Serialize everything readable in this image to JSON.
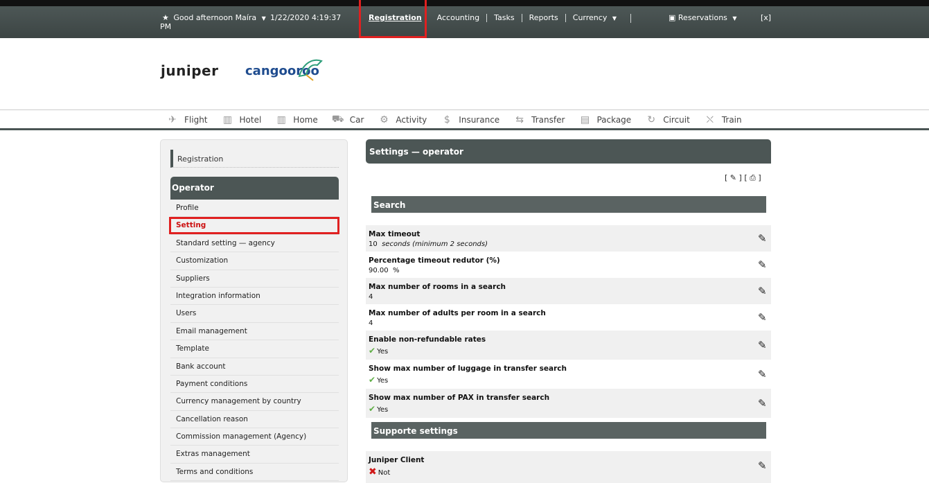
{
  "topbar": {
    "greeting": "Good afternoon Maíra",
    "datetime": "1/22/2020 4:19:37",
    "datetime_suffix": "PM",
    "nav": [
      "Registration",
      "Accounting",
      "Tasks",
      "Reports",
      "Currency"
    ],
    "reservations": "Reservations",
    "close": "[x]"
  },
  "logos": {
    "juniper": "juniper",
    "cangooroo": "cangooroo"
  },
  "products": [
    {
      "label": "Flight",
      "icon": "plane-icon"
    },
    {
      "label": "Hotel",
      "icon": "building-icon"
    },
    {
      "label": "Home",
      "icon": "home-icon"
    },
    {
      "label": "Car",
      "icon": "car-icon"
    },
    {
      "label": "Activity",
      "icon": "activity-icon"
    },
    {
      "label": "Insurance",
      "icon": "dollar-icon"
    },
    {
      "label": "Transfer",
      "icon": "transfer-icon"
    },
    {
      "label": "Package",
      "icon": "package-icon"
    },
    {
      "label": "Circuit",
      "icon": "circuit-icon"
    },
    {
      "label": "Train",
      "icon": "train-icon"
    }
  ],
  "sidebar": {
    "breadcrumb": "Registration",
    "header": "Operator",
    "items": [
      "Profile",
      "Setting",
      "Standard setting — agency",
      "Customization",
      "Suppliers",
      "Integration information",
      "Users",
      "Email management",
      "Template",
      "Bank account",
      "Payment conditions",
      "Currency management by country",
      "Cancellation reason",
      "Commission management (Agency)",
      "Extras management",
      "Terms and conditions"
    ],
    "active_index": 1
  },
  "main": {
    "title": "Settings — operator",
    "tools_text": "[ ✎ ] [ ⎙ ]",
    "sections": [
      {
        "title": "Search"
      },
      {
        "title": "Supporte settings"
      }
    ],
    "rows": [
      {
        "title": "Max timeout",
        "value": "10",
        "note": "seconds (minimum 2 seconds)"
      },
      {
        "title": "Percentage timeout redutor (%)",
        "value": "90.00",
        "note": "%"
      },
      {
        "title": "Max number of rooms in a search",
        "value": "4"
      },
      {
        "title": "Max number of adults per room in a search",
        "value": "4"
      },
      {
        "title": "Enable non-refundable rates",
        "value": "Yes"
      },
      {
        "title": "Show max number of luggage in transfer search",
        "value": "Yes"
      },
      {
        "title": "Show max number of PAX in transfer search",
        "value": "Yes"
      },
      {
        "title": "Juniper Client",
        "value": "Not"
      }
    ]
  },
  "colors": {
    "bar": "#4c5655",
    "highlight": "#e02020",
    "check": "#5fae45",
    "cross": "#d01818"
  }
}
